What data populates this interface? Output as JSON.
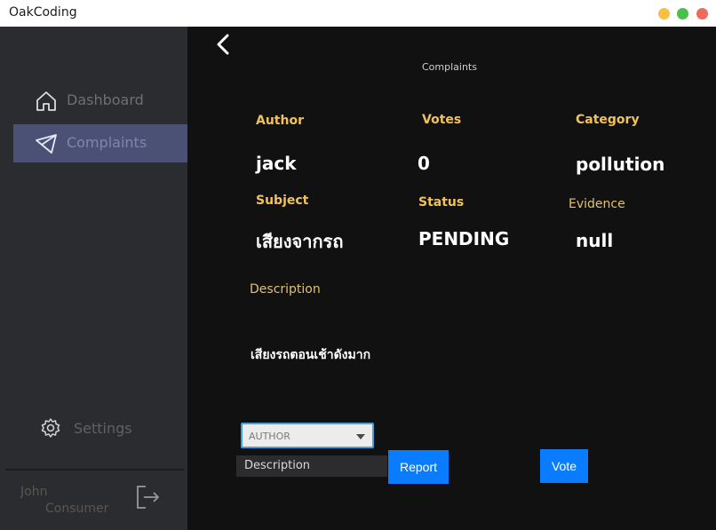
{
  "window": {
    "title": "OakCoding"
  },
  "sidebar": {
    "items": [
      {
        "label": "Dashboard",
        "icon": "home-icon"
      },
      {
        "label": "Complaints",
        "icon": "paper-plane-icon"
      }
    ],
    "settings_label": "Settings",
    "user": {
      "first_name": "John",
      "role": "Consumer"
    }
  },
  "page": {
    "title": "Complaints"
  },
  "complaint": {
    "author_label": "Author",
    "author": "jack",
    "votes_label": "Votes",
    "votes": "0",
    "category_label": "Category",
    "category": "pollution",
    "subject_label": "Subject",
    "subject": "เสียงจากรถ",
    "status_label": "Status",
    "status": "PENDING",
    "evidence_label": "Evidence",
    "evidence": "null",
    "description_label": "Description",
    "description": "เสียงรถตอนเช้าดังมาก"
  },
  "actions": {
    "sort_select_value": "AUTHOR",
    "description_input_value": "Description",
    "report_label": "Report",
    "vote_label": "Vote"
  },
  "colors": {
    "sidebar_bg": "#2b2c30",
    "main_bg": "#111111",
    "active_nav_bg": "#4b5175",
    "label_gold": "#f2c25a",
    "button_blue": "#0a7cff"
  }
}
